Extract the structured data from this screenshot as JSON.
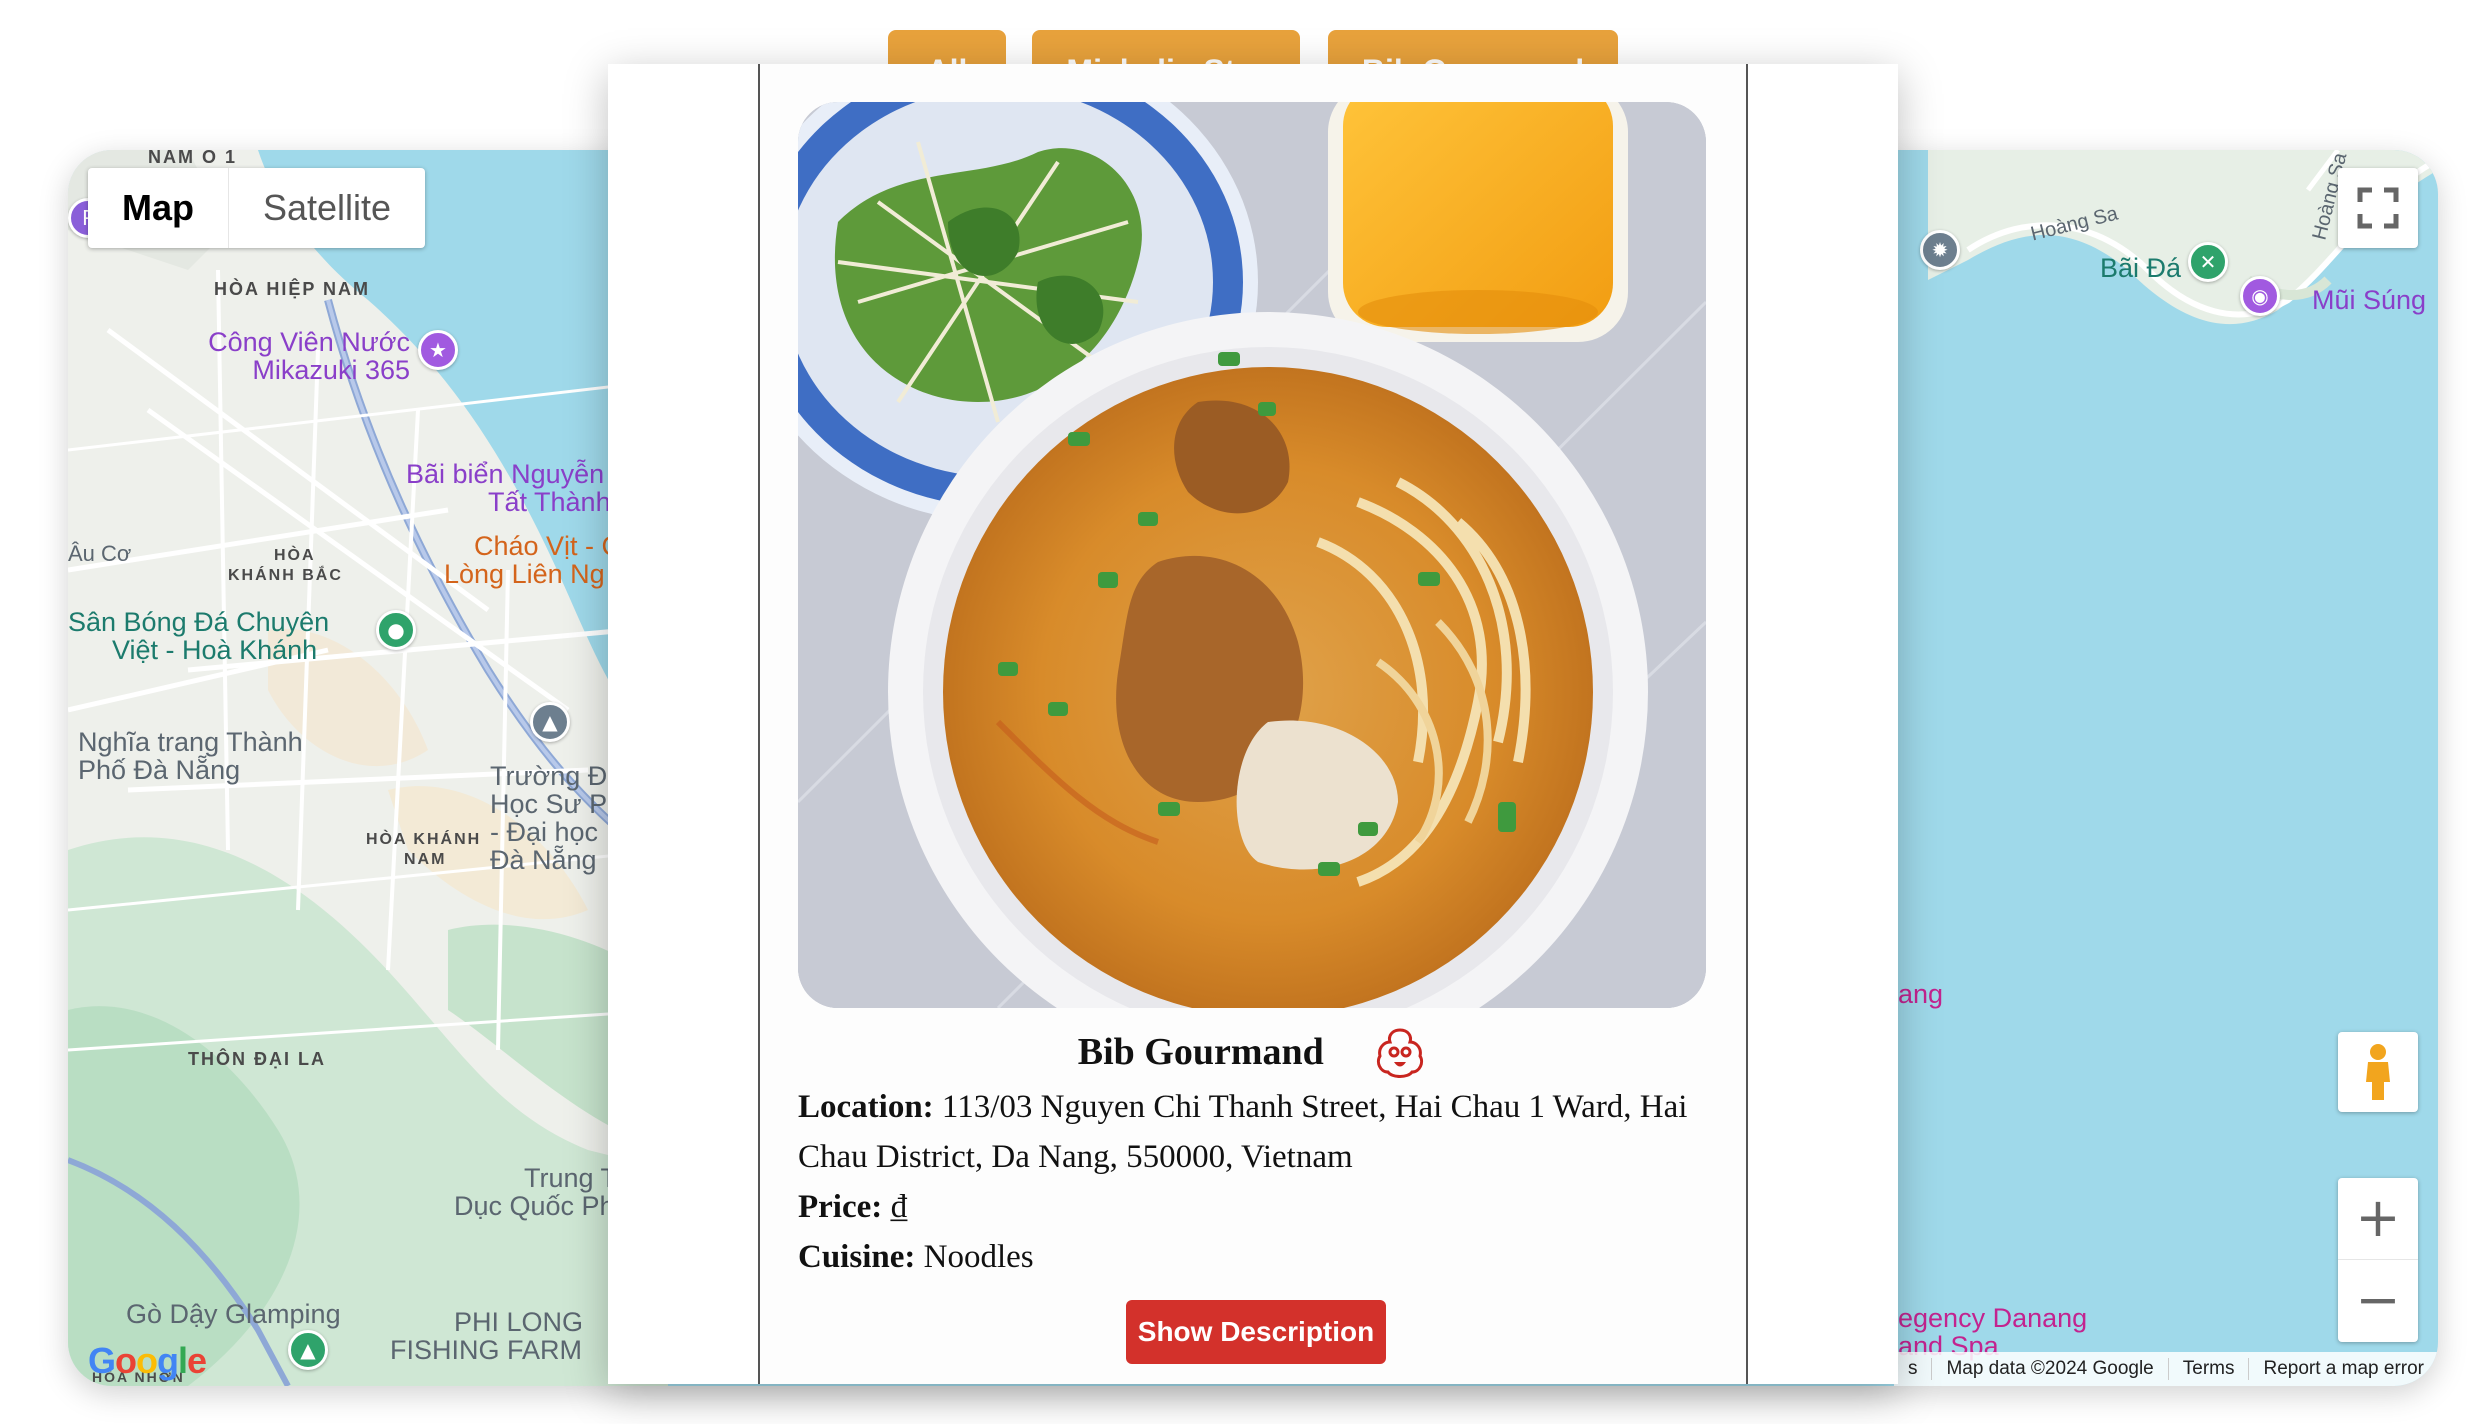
{
  "filters": {
    "all_label": "All",
    "michelin_star_label": "Michelin Star",
    "bib_gourmand_label": "Bib Gourmand",
    "button_color": "#e8a23c"
  },
  "map": {
    "map_type": {
      "map_label": "Map",
      "satellite_label": "Satellite",
      "selected": "Map"
    },
    "labels": {
      "nam_o_1": "NAM Ô 1",
      "hoa_hiep_nam": "HÒA HIỆP NAM",
      "mikazuki_line1": "Công Viên Nước",
      "mikazuki_line2": "Mikazuki 365",
      "bai_bien_line1": "Bãi biển Nguyễn",
      "bai_bien_line2": "Tất Thành",
      "chao_vit_line1": "Cháo Vịt - C",
      "chao_vit_line2": "Lòng Liên Ng",
      "hoa_khanh_bac_line1": "HÒA",
      "hoa_khanh_bac_line2": "KHÁNH BẮC",
      "au_co": "Âu Cơ",
      "san_bong_line1": "Sân Bóng Đá Chuyên",
      "san_bong_line2": "Việt - Hoà Khánh",
      "nghia_trang_line1": "Nghĩa trang Thành",
      "nghia_trang_line2": "Phố Đà Nẵng",
      "truong_line1": "Trường Đ",
      "truong_line2": "Học Sư P",
      "truong_line3": "- Đại học",
      "truong_line4": "Đà Nẵng",
      "hoa_khanh_nam_line1": "HÒA KHÁNH",
      "hoa_khanh_nam_line2": "NAM",
      "thon_dai_la": "THÔN ĐẠI LA",
      "trung_line1": "Trung T",
      "trung_line2": "Dục Quốc Ph",
      "go_day": "Gò Dậy Glamping",
      "phi_long_line1": "PHI LONG",
      "phi_long_line2": "FISHING FARM",
      "hoa_nhon": "HÒA NHƠN",
      "hoang_sa_1": "Hoàng Sa",
      "hoang_sa_2": "Hoàng Sa",
      "bai_da": "Bãi Đá",
      "mui_sung": "Mũi Súng",
      "ang": "ang",
      "regency_line1": "egency Danang",
      "regency_line2": "and Spa"
    },
    "google_logo": "Google",
    "footer": {
      "map_data": "Map data ©2024 Google",
      "terms": "Terms",
      "report": "Report a map error",
      "s": "s"
    },
    "zoom_in_symbol": "+",
    "zoom_out_symbol": "−",
    "icons": [
      "fullscreen-icon",
      "pegman-icon",
      "zoom-in-icon",
      "zoom-out-icon"
    ]
  },
  "card": {
    "title": "Bib Gourmand",
    "badge_icon": "michelin-bibendum-icon",
    "location_label": "Location:",
    "location_value": "113/03 Nguyen Chi Thanh Street, Hai Chau 1 Ward, Hai Chau District, Da Nang, 550000, Vietnam",
    "price_label": "Price:",
    "price_value": "₫",
    "cuisine_label": "Cuisine:",
    "cuisine_value": "Noodles",
    "button_label": "Show Description",
    "button_color": "#d3312b"
  }
}
